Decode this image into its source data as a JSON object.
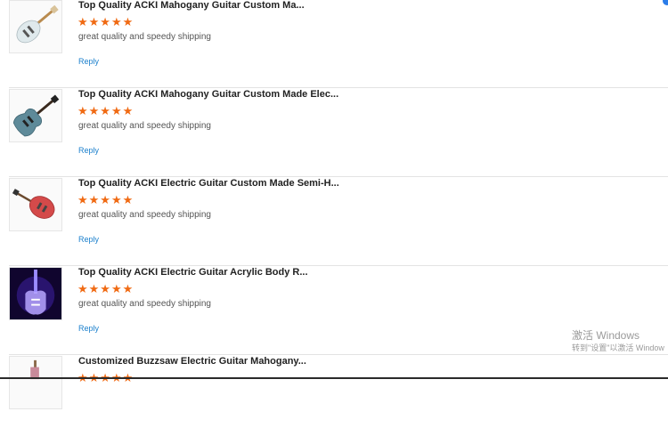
{
  "reviews": [
    {
      "title": "Top Quality ACKI Mahogany Guitar Custom Ma...",
      "stars": "★★★★★",
      "rating": 5,
      "comment": "great quality and speedy shipping",
      "reply_label": "Reply",
      "thumb": "white-electric-guitar"
    },
    {
      "title": "Top Quality ACKI Mahogany Guitar Custom Made Elec...",
      "stars": "★★★★★",
      "rating": 5,
      "comment": "great quality and speedy shipping",
      "reply_label": "Reply",
      "thumb": "blue-sg-guitar"
    },
    {
      "title": "Top Quality ACKI Electric Guitar Custom Made Semi-H...",
      "stars": "★★★★★",
      "rating": 5,
      "comment": "great quality and speedy shipping",
      "reply_label": "Reply",
      "thumb": "red-semi-hollow-guitar"
    },
    {
      "title": "Top Quality ACKI Electric Guitar Acrylic Body R...",
      "stars": "★★★★★",
      "rating": 5,
      "comment": "great quality and speedy shipping",
      "reply_label": "Reply",
      "thumb": "acrylic-led-guitar"
    },
    {
      "title": "Customized Buzzsaw Electric Guitar Mahogany...",
      "stars": "★★★★★",
      "rating": 5,
      "comment": "",
      "reply_label": "",
      "thumb": "buzzsaw-guitar"
    }
  ],
  "watermark": {
    "line1": "激活 Windows",
    "line2": "转到\"设置\"以激活 Window"
  },
  "colors": {
    "star": "#f06a13",
    "reply": "#1a7fcc",
    "divider": "#e3e3e3"
  }
}
